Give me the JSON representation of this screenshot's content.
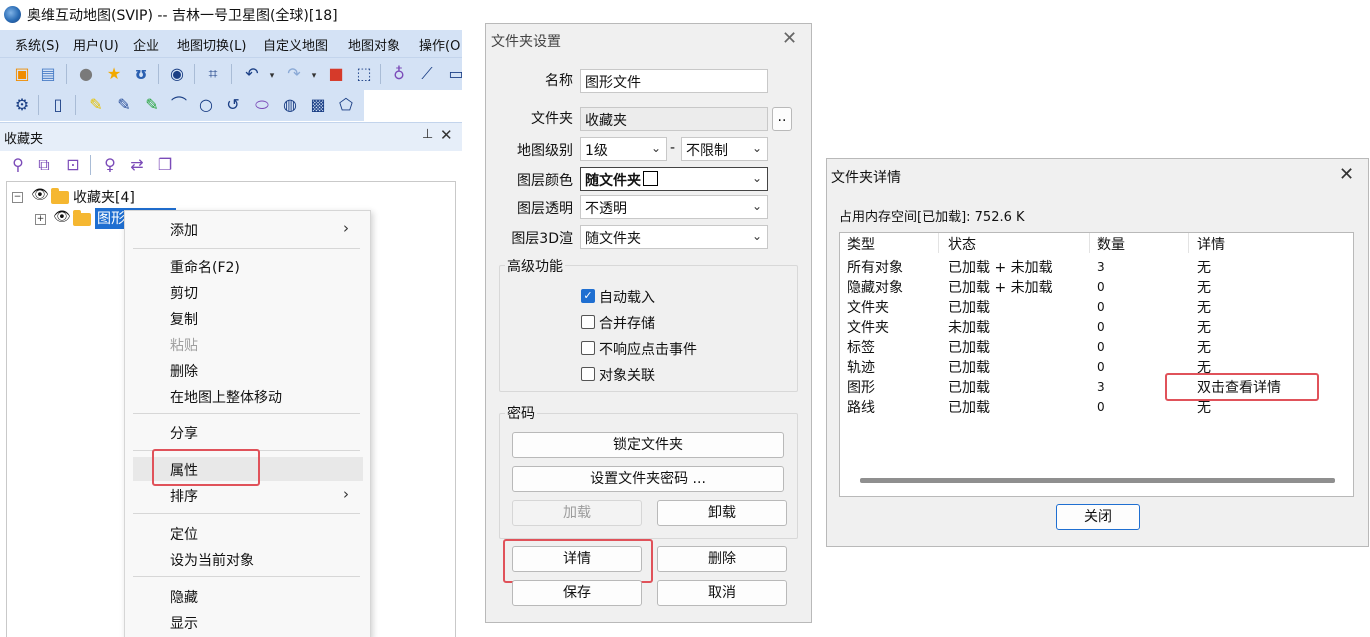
{
  "app": {
    "title": "奥维互动地图(SVIP) -- 吉林一号卫星图(全球)[18]",
    "menus": [
      "系统(S)",
      "用户(U)",
      "企业",
      "地图切换(L)",
      "自定义地图",
      "地图对象",
      "操作(O"
    ],
    "toolbar1_icons": [
      "new-folder-icon",
      "save-icon",
      "users-icon",
      "star-icon",
      "route-icon",
      "layers-icon",
      "crop-icon",
      "undo-icon",
      "redo-icon",
      "delete-icon",
      "select-icon",
      "pin-user-icon",
      "ruler-icon",
      "keyboard-icon"
    ],
    "toolbar2_icons": [
      "settings-icon",
      "document-icon",
      "yellow-pin-icon",
      "blue-pin-icon",
      "green-pin-icon",
      "arc-icon",
      "circle-icon",
      "refresh-arc-icon",
      "ellipse-icon",
      "hatched-circle-icon",
      "hatched-square-icon",
      "polygon-icon"
    ],
    "favorites_panel": {
      "title": "收藏夹",
      "pin_icon": "pin-icon",
      "close_icon": "close-icon",
      "tools": [
        "search-icon",
        "windows-icon",
        "focus-icon",
        "location-icon",
        "sync-icon",
        "copy-icon"
      ]
    },
    "tree": {
      "root_label": "收藏夹[4]",
      "root_expander": "⊟",
      "child_label": "图形",
      "child_expander": "⊞"
    },
    "context_menu": {
      "items": [
        {
          "label": "添加",
          "submenu": true
        },
        {
          "label": "重命名(F2)"
        },
        {
          "label": "剪切"
        },
        {
          "label": "复制"
        },
        {
          "label": "粘贴",
          "disabled": true
        },
        {
          "label": "删除"
        },
        {
          "label": "在地图上整体移动"
        },
        {
          "label": "分享"
        },
        {
          "label": "属性"
        },
        {
          "label": "排序",
          "submenu": true
        },
        {
          "label": "定位"
        },
        {
          "label": "设为当前对象"
        },
        {
          "label": "隐藏"
        },
        {
          "label": "显示"
        }
      ],
      "arrow": "›"
    }
  },
  "folder_settings": {
    "title": "文件夹设置",
    "close": "✕",
    "name_label": "名称",
    "name_value": "图形文件",
    "folder_label": "文件夹",
    "folder_value": "收藏夹",
    "browse_button": "..",
    "level_label": "地图级别",
    "level_from": "1级",
    "level_dash": "-",
    "level_to": "不限制",
    "color_label": "图层颜色",
    "color_value": "随文件夹",
    "opacity_label": "图层透明",
    "opacity_value": "不透明",
    "render3d_label": "图层3D渲",
    "render3d_value": "随文件夹",
    "advanced_group": "高级功能",
    "checkboxes": [
      {
        "label": "自动载入",
        "checked": true
      },
      {
        "label": "合并存储",
        "checked": false
      },
      {
        "label": "不响应点击事件",
        "checked": false
      },
      {
        "label": "对象关联",
        "checked": false
      }
    ],
    "password_group": "密码",
    "lock_button": "锁定文件夹",
    "set_password_button": "设置文件夹密码 ...",
    "load_button": "加载",
    "unload_button": "卸载",
    "details_button": "详情",
    "delete_button": "删除",
    "save_button": "保存",
    "cancel_button": "取消",
    "dropdown_glyph": "⌄",
    "check_glyph": "✓"
  },
  "folder_details": {
    "title": "文件夹详情",
    "close": "✕",
    "memory_text": "占用内存空间[已加载]: 752.6 K",
    "columns": [
      "类型",
      "状态",
      "数量",
      "详情"
    ],
    "rows": [
      {
        "type": "所有对象",
        "status": "已加载 + 未加载",
        "count": "3",
        "detail": "无"
      },
      {
        "type": "隐藏对象",
        "status": "已加载 + 未加载",
        "count": "0",
        "detail": "无"
      },
      {
        "type": "文件夹",
        "status": "已加载",
        "count": "0",
        "detail": "无"
      },
      {
        "type": "文件夹",
        "status": "未加载",
        "count": "0",
        "detail": "无"
      },
      {
        "type": "标签",
        "status": "已加载",
        "count": "0",
        "detail": "无"
      },
      {
        "type": "轨迹",
        "status": "已加载",
        "count": "0",
        "detail": "无"
      },
      {
        "type": "图形",
        "status": "已加载",
        "count": "3",
        "detail": "双击查看详情"
      },
      {
        "type": "路线",
        "status": "已加载",
        "count": "0",
        "detail": "无"
      }
    ],
    "close_button": "关闭"
  }
}
